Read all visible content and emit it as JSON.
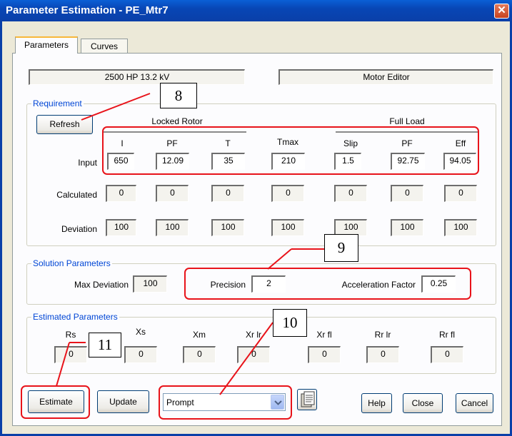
{
  "window": {
    "title": "Parameter Estimation - PE_Mtr7",
    "close_glyph": "✕"
  },
  "tabs": [
    {
      "label": "Parameters"
    },
    {
      "label": "Curves"
    }
  ],
  "header": {
    "motor_info": "2500 HP  13.2 kV",
    "source": "Motor Editor"
  },
  "requirement": {
    "group_label": "Requirement",
    "refresh_label": "Refresh",
    "locked_rotor_label": "Locked Rotor",
    "full_load_label": "Full Load",
    "columns": [
      "I",
      "PF",
      "T",
      "Tmax",
      "Slip",
      "PF",
      "Eff"
    ],
    "row_labels": {
      "input": "Input",
      "calculated": "Calculated",
      "deviation": "Deviation"
    },
    "input": [
      "650",
      "12.09",
      "35",
      "210",
      "1.5",
      "92.75",
      "94.05"
    ],
    "calculated": [
      "0",
      "0",
      "0",
      "0",
      "0",
      "0",
      "0"
    ],
    "deviation": [
      "100",
      "100",
      "100",
      "100",
      "100",
      "100",
      "100"
    ]
  },
  "solution": {
    "group_label": "Solution Parameters",
    "max_deviation_label": "Max Deviation",
    "max_deviation": "100",
    "precision_label": "Precision",
    "precision": "2",
    "accel_label": "Acceleration Factor",
    "accel": "0.25"
  },
  "estimated": {
    "group_label": "Estimated Parameters",
    "columns": [
      "Rs",
      "Xs",
      "Xm",
      "Xr lr",
      "Xr fl",
      "Rr lr",
      "Rr fl"
    ],
    "values": [
      "0",
      "0",
      "0",
      "0",
      "0",
      "0",
      "0"
    ]
  },
  "footer": {
    "estimate_label": "Estimate",
    "update_label": "Update",
    "prompt_value": "Prompt",
    "help_label": "Help",
    "close_label": "Close",
    "cancel_label": "Cancel"
  },
  "callouts": [
    "8",
    "9",
    "10",
    "11"
  ],
  "colors": {
    "title_bar": "#0a46b5",
    "group_label": "#0046d5",
    "highlight": "#e8131a",
    "dialog_bg": "#ece9d8"
  }
}
